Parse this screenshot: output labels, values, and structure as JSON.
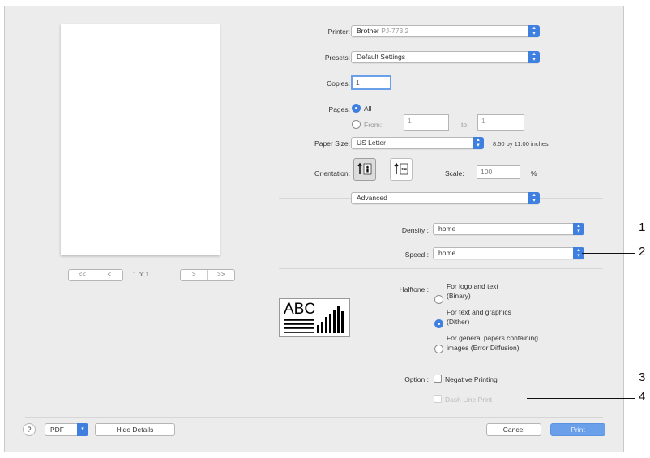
{
  "printer": {
    "label": "Printer:",
    "value_prefix": "Brother",
    "value_model": "PJ-773 2"
  },
  "presets": {
    "label": "Presets:",
    "value": "Default Settings"
  },
  "copies": {
    "label": "Copies:",
    "value": "1"
  },
  "pages": {
    "label": "Pages:",
    "all_label": "All",
    "from_label": "From:",
    "from_value": "1",
    "to_label": "to:",
    "to_value": "1"
  },
  "paper_size": {
    "label": "Paper Size:",
    "value": "US Letter",
    "dimensions": "8.50 by 11.00 inches"
  },
  "orientation": {
    "label": "Orientation:",
    "scale_label": "Scale:",
    "scale_value": "100",
    "percent": "%"
  },
  "section_popup": {
    "value": "Advanced"
  },
  "density": {
    "label": "Density :",
    "value": "home"
  },
  "speed": {
    "label": "Speed :",
    "value": "home"
  },
  "halftone": {
    "label": "Halftone :",
    "preview_text": "ABC",
    "options": [
      {
        "line1": "For logo and text",
        "line2": "(Binary)"
      },
      {
        "line1": "For text and graphics",
        "line2": "(Dither)"
      },
      {
        "line1": "For general papers containing",
        "line2": "images (Error Diffusion)"
      }
    ]
  },
  "option": {
    "label": "Option :",
    "negative_printing": "Negative Printing",
    "dash_line_print": "Dash Line Print"
  },
  "preview_nav": {
    "first": "<<",
    "prev": "<",
    "page_info": "1 of 1",
    "next": ">",
    "last": ">>"
  },
  "footer": {
    "help": "?",
    "pdf": "PDF",
    "hide_details": "Hide Details",
    "cancel": "Cancel",
    "print": "Print"
  },
  "callouts": [
    "1",
    "2",
    "3",
    "4"
  ],
  "colors": {
    "accent": "#3f7fe0",
    "dialog_bg": "#ececec"
  }
}
